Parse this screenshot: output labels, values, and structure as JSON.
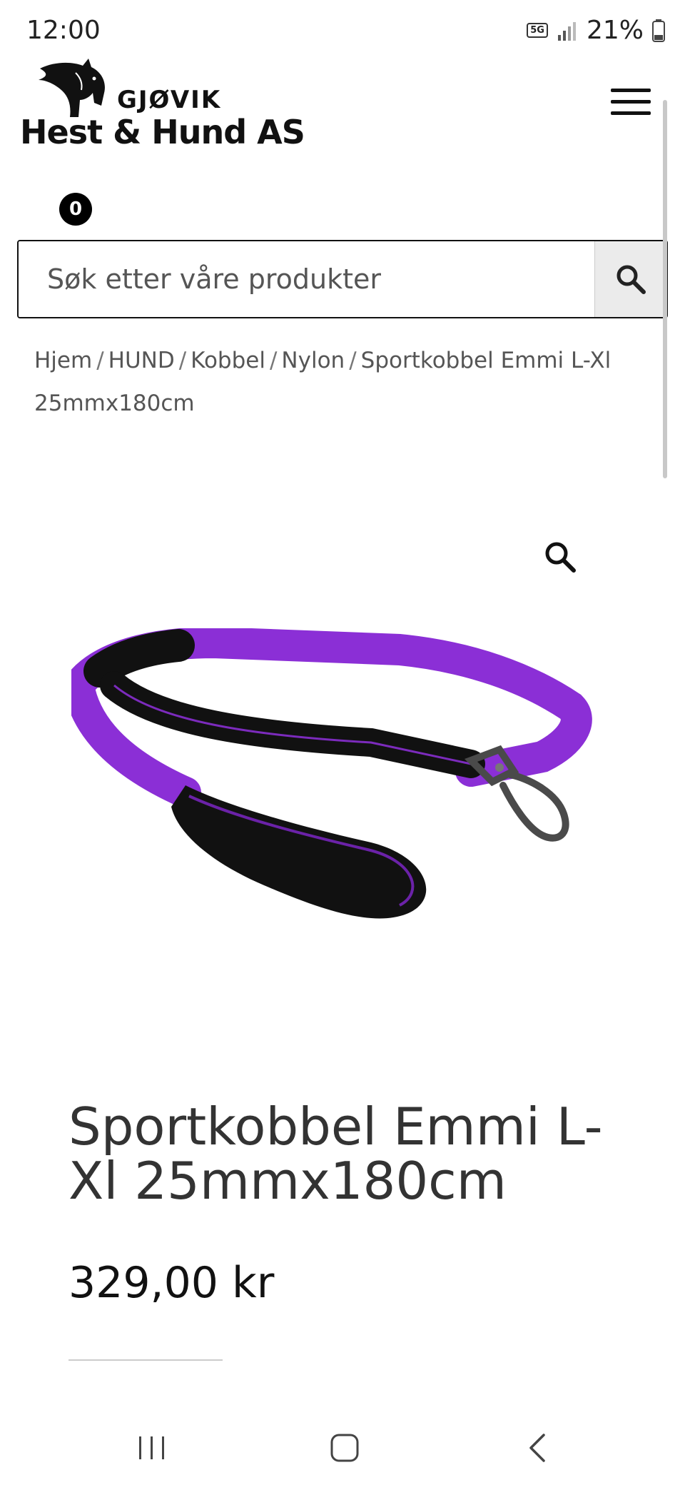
{
  "status_bar": {
    "time": "12:00",
    "network": "5G",
    "battery": "21%"
  },
  "header": {
    "logo_small": "GJØVIK",
    "logo_main": "Hest & Hund AS",
    "cart_count": "0"
  },
  "search": {
    "placeholder": "Søk etter våre produkter"
  },
  "breadcrumb": {
    "items": [
      "Hjem",
      "HUND",
      "Kobbel",
      "Nylon"
    ],
    "current": "Sportkobbel Emmi L-Xl 25mmx180cm",
    "separator": "/"
  },
  "product": {
    "title": "Sportkobbel Emmi L-Xl 25mmx180cm",
    "price": "329,00 kr",
    "image_alt_colors": {
      "strap": "#8a2be2",
      "handle": "#111111",
      "clip": "#555555"
    }
  },
  "icons": {
    "menu": "hamburger-menu-icon",
    "search": "search-icon",
    "zoom": "zoom-icon",
    "nav_recent": "recent-apps-icon",
    "nav_home": "home-icon",
    "nav_back": "back-icon"
  }
}
